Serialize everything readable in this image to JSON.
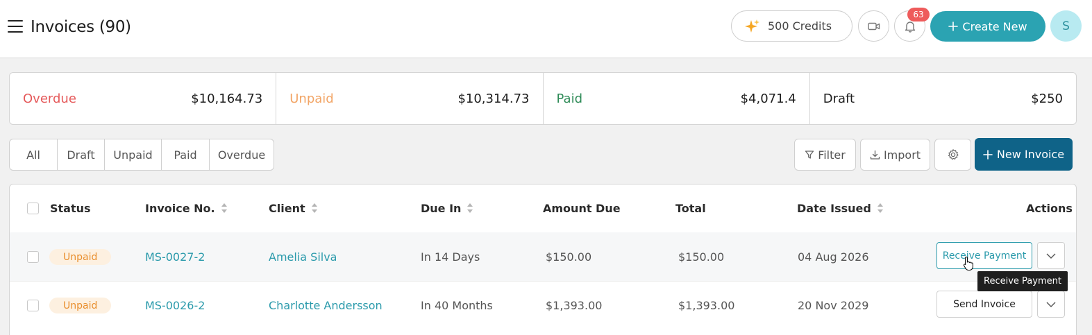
{
  "header": {
    "title": "Invoices (90)",
    "credits_label": "500 Credits",
    "notification_count": "63",
    "create_label": "Create New",
    "avatar_initial": "S"
  },
  "summary": [
    {
      "label": "Overdue",
      "amount": "$10,164.73",
      "color": "#e5595a"
    },
    {
      "label": "Unpaid",
      "amount": "$10,314.73",
      "color": "#f2a566"
    },
    {
      "label": "Paid",
      "amount": "$4,071.4",
      "color": "#2e8b57"
    },
    {
      "label": "Draft",
      "amount": "$250",
      "color": "#1d1d1d"
    }
  ],
  "tabs": [
    "All",
    "Draft",
    "Unpaid",
    "Paid",
    "Overdue"
  ],
  "toolbar": {
    "filter_label": "Filter",
    "import_label": "Import",
    "new_invoice_label": "New Invoice"
  },
  "table": {
    "columns": {
      "status": "Status",
      "invoice_no": "Invoice No.",
      "client": "Client",
      "due_in": "Due In",
      "amount_due": "Amount Due",
      "total": "Total",
      "date_issued": "Date Issued",
      "actions": "Actions"
    },
    "rows": [
      {
        "status": "Unpaid",
        "invoice_no": "MS-0027-2",
        "client": "Amelia Silva",
        "due_in": "In 14 Days",
        "amount_due": "$150.00",
        "total": "$150.00",
        "date_issued": "04 Aug 2026",
        "action": "Receive Payment"
      },
      {
        "status": "Unpaid",
        "invoice_no": "MS-0026-2",
        "client": "Charlotte Andersson",
        "due_in": "In 40 Months",
        "amount_due": "$1,393.00",
        "total": "$1,393.00",
        "date_issued": "20 Nov 2029",
        "action": "Send Invoice"
      }
    ]
  },
  "tooltip": "Receive Payment",
  "colors": {
    "accent": "#2ba3b2",
    "primary": "#0f6388",
    "badge": "#ee5b5b"
  }
}
